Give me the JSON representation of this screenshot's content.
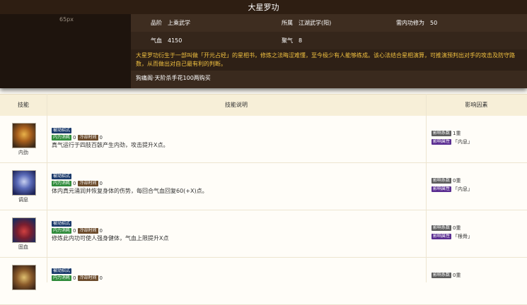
{
  "skill": {
    "name": "大星罗功",
    "image_placeholder": "65px",
    "grade_label": "品阶",
    "grade": "上乘武学",
    "school_label": "所属",
    "school": "江湖武学(阳)",
    "req_label": "需内功修为",
    "req": "50",
    "hp_label": "气血",
    "hp": "4150",
    "qi_label": "聚气",
    "qi": "8",
    "description": "大星罗功衍生于一部叫做「开元占经」的星相书，修炼之法晦涩难懂，至今极少有人能够练成。该心法结合星相演算，可推演预判出对手的攻击及防守路数，从而做出对自己最有利的判断。",
    "source": "狗痛阁·天阶杀手花100两购买"
  },
  "table": {
    "headers": [
      "技能",
      "技能说明",
      "影响因素"
    ],
    "rows": [
      {
        "icon": "meditating-figure-icon",
        "name": "内劲",
        "tag_type": "被动招式",
        "tag_neili": "内力消耗",
        "neili": "0",
        "tag_cd": "冷却时间",
        "cd": "0",
        "text": "真气运行于四肢百骸产生内劲，攻击提升X点。",
        "tag_lv": "影响系数",
        "lv": "1重",
        "tag_attr": "影响属性",
        "attr": "「内息」"
      },
      {
        "icon": "seated-meditation-icon",
        "name": "调息",
        "tag_type": "被动招式",
        "tag_neili": "内力消耗",
        "neili": "0",
        "tag_cd": "冷却时间",
        "cd": "0",
        "text": "体内真元涌润并恢复身体的伤势，每回合气血回复60(+X)点。",
        "tag_lv": "影响系数",
        "lv": "0重",
        "tag_attr": "影响属性",
        "attr": "「内息」"
      },
      {
        "icon": "blood-heart-icon",
        "name": "固血",
        "tag_type": "被动招式",
        "tag_neili": "内力消耗",
        "neili": "0",
        "tag_cd": "冷却时间",
        "cd": "0",
        "text": "修炼此内功可使人强身健体，气血上限提升X点",
        "tag_lv": "影响系数",
        "lv": "0重",
        "tag_attr": "影响属性",
        "attr": "「根骨」"
      },
      {
        "icon": "swirl-wave-icon",
        "name": "",
        "tag_type": "被动招式",
        "tag_neili": "内力消耗",
        "neili": "0",
        "tag_cd": "冷却时间",
        "cd": "0",
        "text": "",
        "tag_lv": "影响系数",
        "lv": "0重",
        "tag_attr": "",
        "attr": ""
      }
    ]
  }
}
